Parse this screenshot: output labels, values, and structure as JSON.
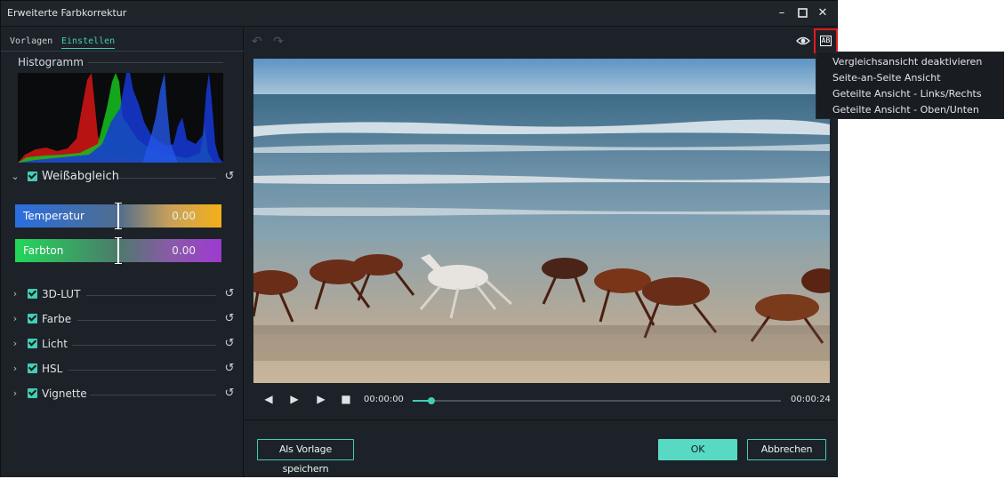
{
  "window": {
    "title": "Erweiterte Farbkorrektur",
    "controls": [
      "minimize-icon",
      "maximize-icon",
      "close-icon"
    ]
  },
  "tabs": [
    {
      "label": "Vorlagen",
      "active": false
    },
    {
      "label": "Einstellen",
      "active": true
    }
  ],
  "histogram": {
    "label": "Histogramm"
  },
  "white_balance": {
    "label": "Weißabgleich",
    "expanded": true,
    "checked": true,
    "temperature": {
      "label": "Temperatur",
      "value": "0.00"
    },
    "tint": {
      "label": "Farbton",
      "value": "0.00"
    }
  },
  "sections": [
    {
      "label": "3D-LUT",
      "checked": true
    },
    {
      "label": "Farbe",
      "checked": true
    },
    {
      "label": "Licht",
      "checked": true
    },
    {
      "label": "HSL",
      "checked": true
    },
    {
      "label": "Vignette",
      "checked": true
    }
  ],
  "player": {
    "current_time": "00:00:00",
    "duration": "00:00:24",
    "progress_fraction": 0.05
  },
  "buttons": {
    "save_template": "Als Vorlage speichern",
    "ok": "OK",
    "cancel": "Abbrechen"
  },
  "compare_button": {
    "icon": "ab-compare-icon",
    "text": "AB"
  },
  "compare_menu": [
    "Vergleichsansicht deaktivieren",
    "Seite-an-Seite Ansicht",
    "Geteilte Ansicht - Links/Rechts",
    "Geteilte Ansicht - Oben/Unten"
  ],
  "colors": {
    "accent": "#43cdb6",
    "highlight_border": "#e31b1b",
    "background": "#1d2228"
  }
}
